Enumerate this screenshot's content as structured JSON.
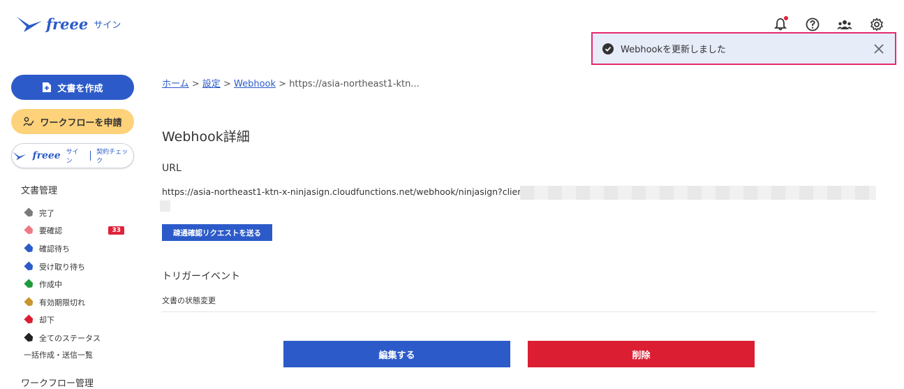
{
  "app": {
    "logo_word": "freee",
    "logo_sub": "サイン"
  },
  "header": {
    "icons": [
      "bell-icon",
      "help-icon",
      "team-icon",
      "gear-icon"
    ]
  },
  "toast": {
    "message": "Webhookを更新しました"
  },
  "sidebar": {
    "create_label": "文書を作成",
    "workflow_label": "ワークフローを申請",
    "check": {
      "word": "freee",
      "sub": "サイン",
      "suffix": "契約チェック"
    },
    "section_title": "文書管理",
    "items": [
      {
        "label": "完了",
        "color": "#7a7a7a"
      },
      {
        "label": "要確認",
        "color": "#ee7a86",
        "badge": "33"
      },
      {
        "label": "確認待ち",
        "color": "#2c5bc9"
      },
      {
        "label": "受け取り待ち",
        "color": "#2c5bc9"
      },
      {
        "label": "作成中",
        "color": "#1f9a3c"
      },
      {
        "label": "有効期限切れ",
        "color": "#c9952c"
      },
      {
        "label": "却下",
        "color": "#dc1e33"
      },
      {
        "label": "全てのステータス",
        "color": "#222222"
      }
    ],
    "bulk_label": "一括作成・送信一覧",
    "next_section": "ワークフロー管理"
  },
  "breadcrumb": {
    "home": "ホーム",
    "settings": "設定",
    "webhook": "Webhook",
    "current": "https://asia-northeast1-ktn..."
  },
  "main": {
    "title": "Webhook詳細",
    "url_label": "URL",
    "url_value": "https://asia-northeast1-ktn-x-ninjasign.cloudfunctions.net/webhook/ninjasign?client=",
    "test_button": "疎通確認リクエストを送る",
    "trigger_label": "トリガーイベント",
    "trigger_value": "文書の状態変更",
    "edit_button": "編集する",
    "delete_button": "削除"
  }
}
